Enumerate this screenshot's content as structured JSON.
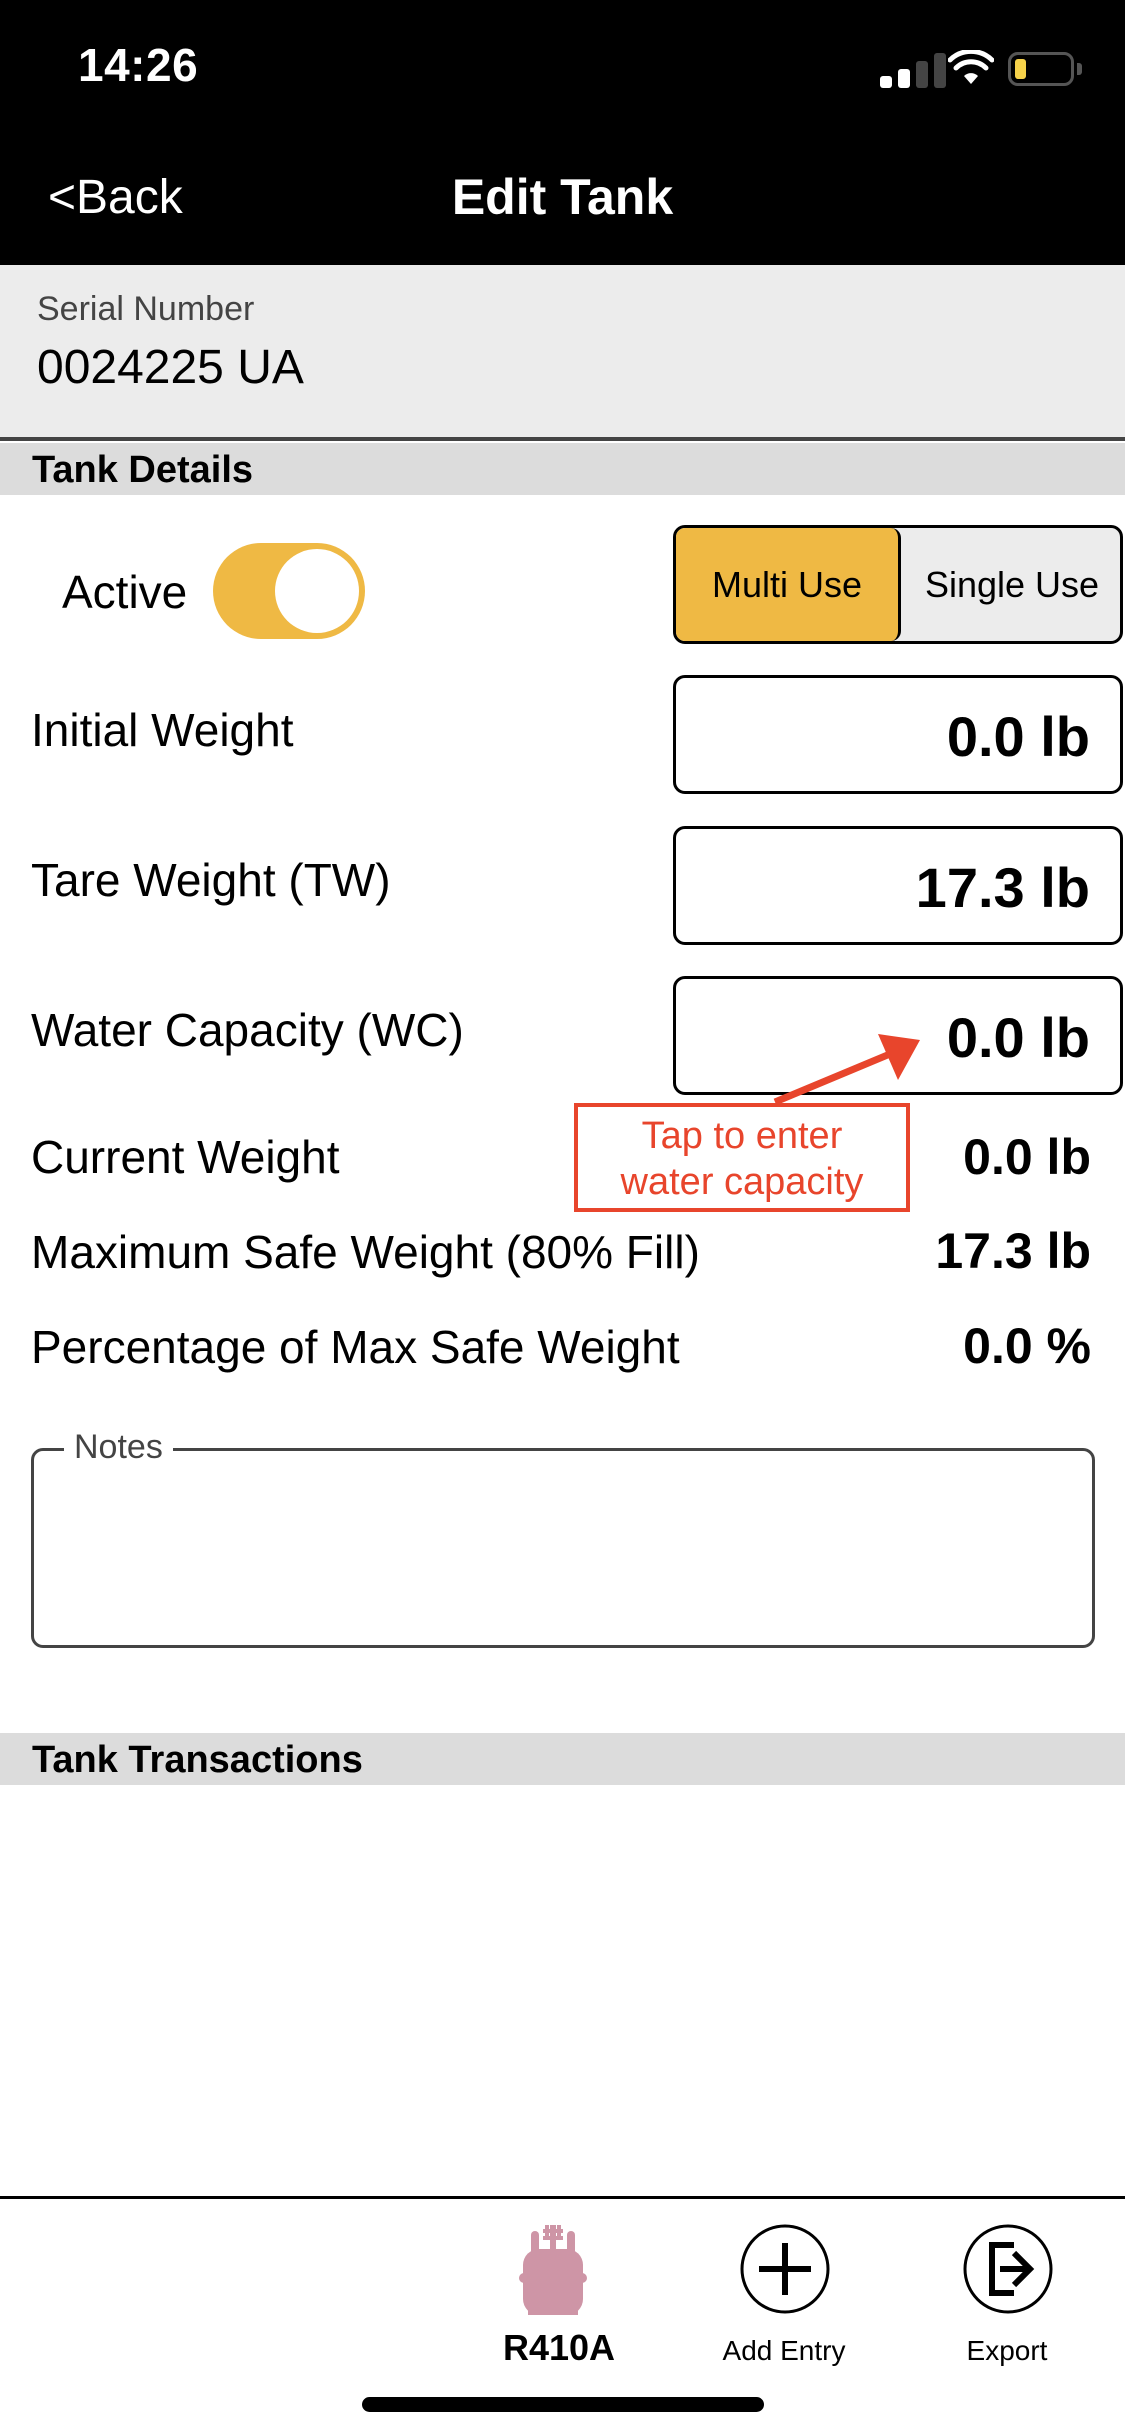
{
  "status_bar": {
    "time": "14:26",
    "signal_bars_active": 2,
    "signal_bars_total": 4,
    "battery_level": "low",
    "battery_color": "#F6D24A"
  },
  "nav": {
    "back_label": "<Back",
    "title": "Edit Tank"
  },
  "serial": {
    "label": "Serial Number",
    "value": "0024225 UA"
  },
  "tank_details": {
    "header": "Tank Details",
    "active": {
      "label": "Active",
      "on": true
    },
    "use_type": {
      "options": [
        "Multi Use",
        "Single Use"
      ],
      "selected": "Multi Use"
    },
    "fields": [
      {
        "label": "Initial Weight",
        "value": "0.0 lb"
      },
      {
        "label": "Tare Weight (TW)",
        "value": "17.3 lb"
      },
      {
        "label": "Water Capacity (WC)",
        "value": "0.0 lb"
      }
    ],
    "readonly": [
      {
        "label": "Current Weight",
        "value": "0.0 lb"
      },
      {
        "label": "Maximum Safe Weight (80% Fill)",
        "value": "17.3 lb"
      },
      {
        "label": "Percentage of Max Safe Weight",
        "value": "0.0 %"
      }
    ],
    "notes": {
      "label": "Notes",
      "value": ""
    }
  },
  "callout": {
    "line1": "Tap to enter",
    "line2": "water capacity",
    "color": "#E8452C"
  },
  "transactions": {
    "header": "Tank Transactions"
  },
  "tab_bar": {
    "items": [
      {
        "label": "R410A",
        "icon": "refrigerant-tank-icon",
        "icon_color": "#CE95A6"
      },
      {
        "label": "Add Entry",
        "icon": "add-circle-icon"
      },
      {
        "label": "Export",
        "icon": "export-icon"
      }
    ]
  },
  "colors": {
    "accent": "#EFB944",
    "header_bg": "#000000",
    "section_bg": "#DCDCDC",
    "serial_bg": "#ECECEC"
  }
}
